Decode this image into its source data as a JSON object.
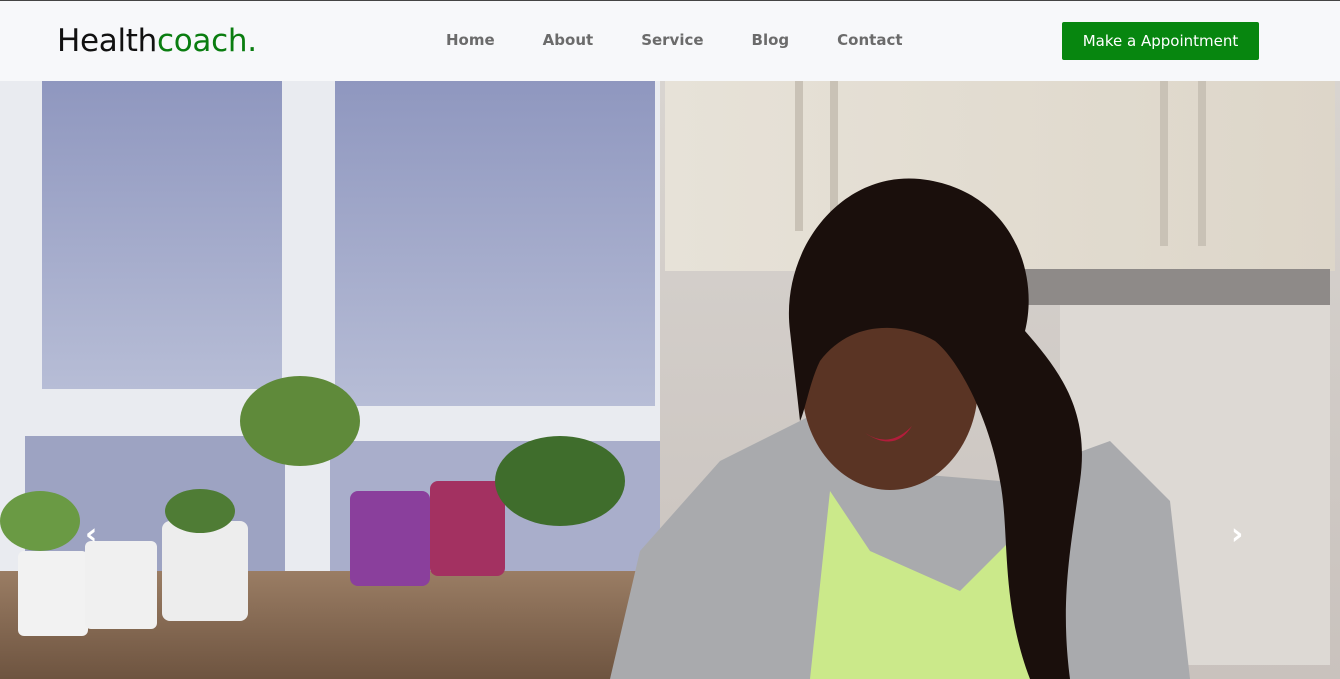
{
  "logo": {
    "main": "Health",
    "accent": "coach."
  },
  "nav": {
    "items": [
      "Home",
      "About",
      "Service",
      "Blog",
      "Contact"
    ]
  },
  "cta": {
    "label": "Make a Appointment"
  },
  "carousel": {
    "prev_icon": "chevron-left-icon",
    "next_icon": "chevron-right-icon",
    "prev_glyph": "‹",
    "next_glyph": "›"
  },
  "colors": {
    "accent": "#07860f",
    "nav_text": "#6b6b6b",
    "header_bg": "#f7f8fa"
  }
}
